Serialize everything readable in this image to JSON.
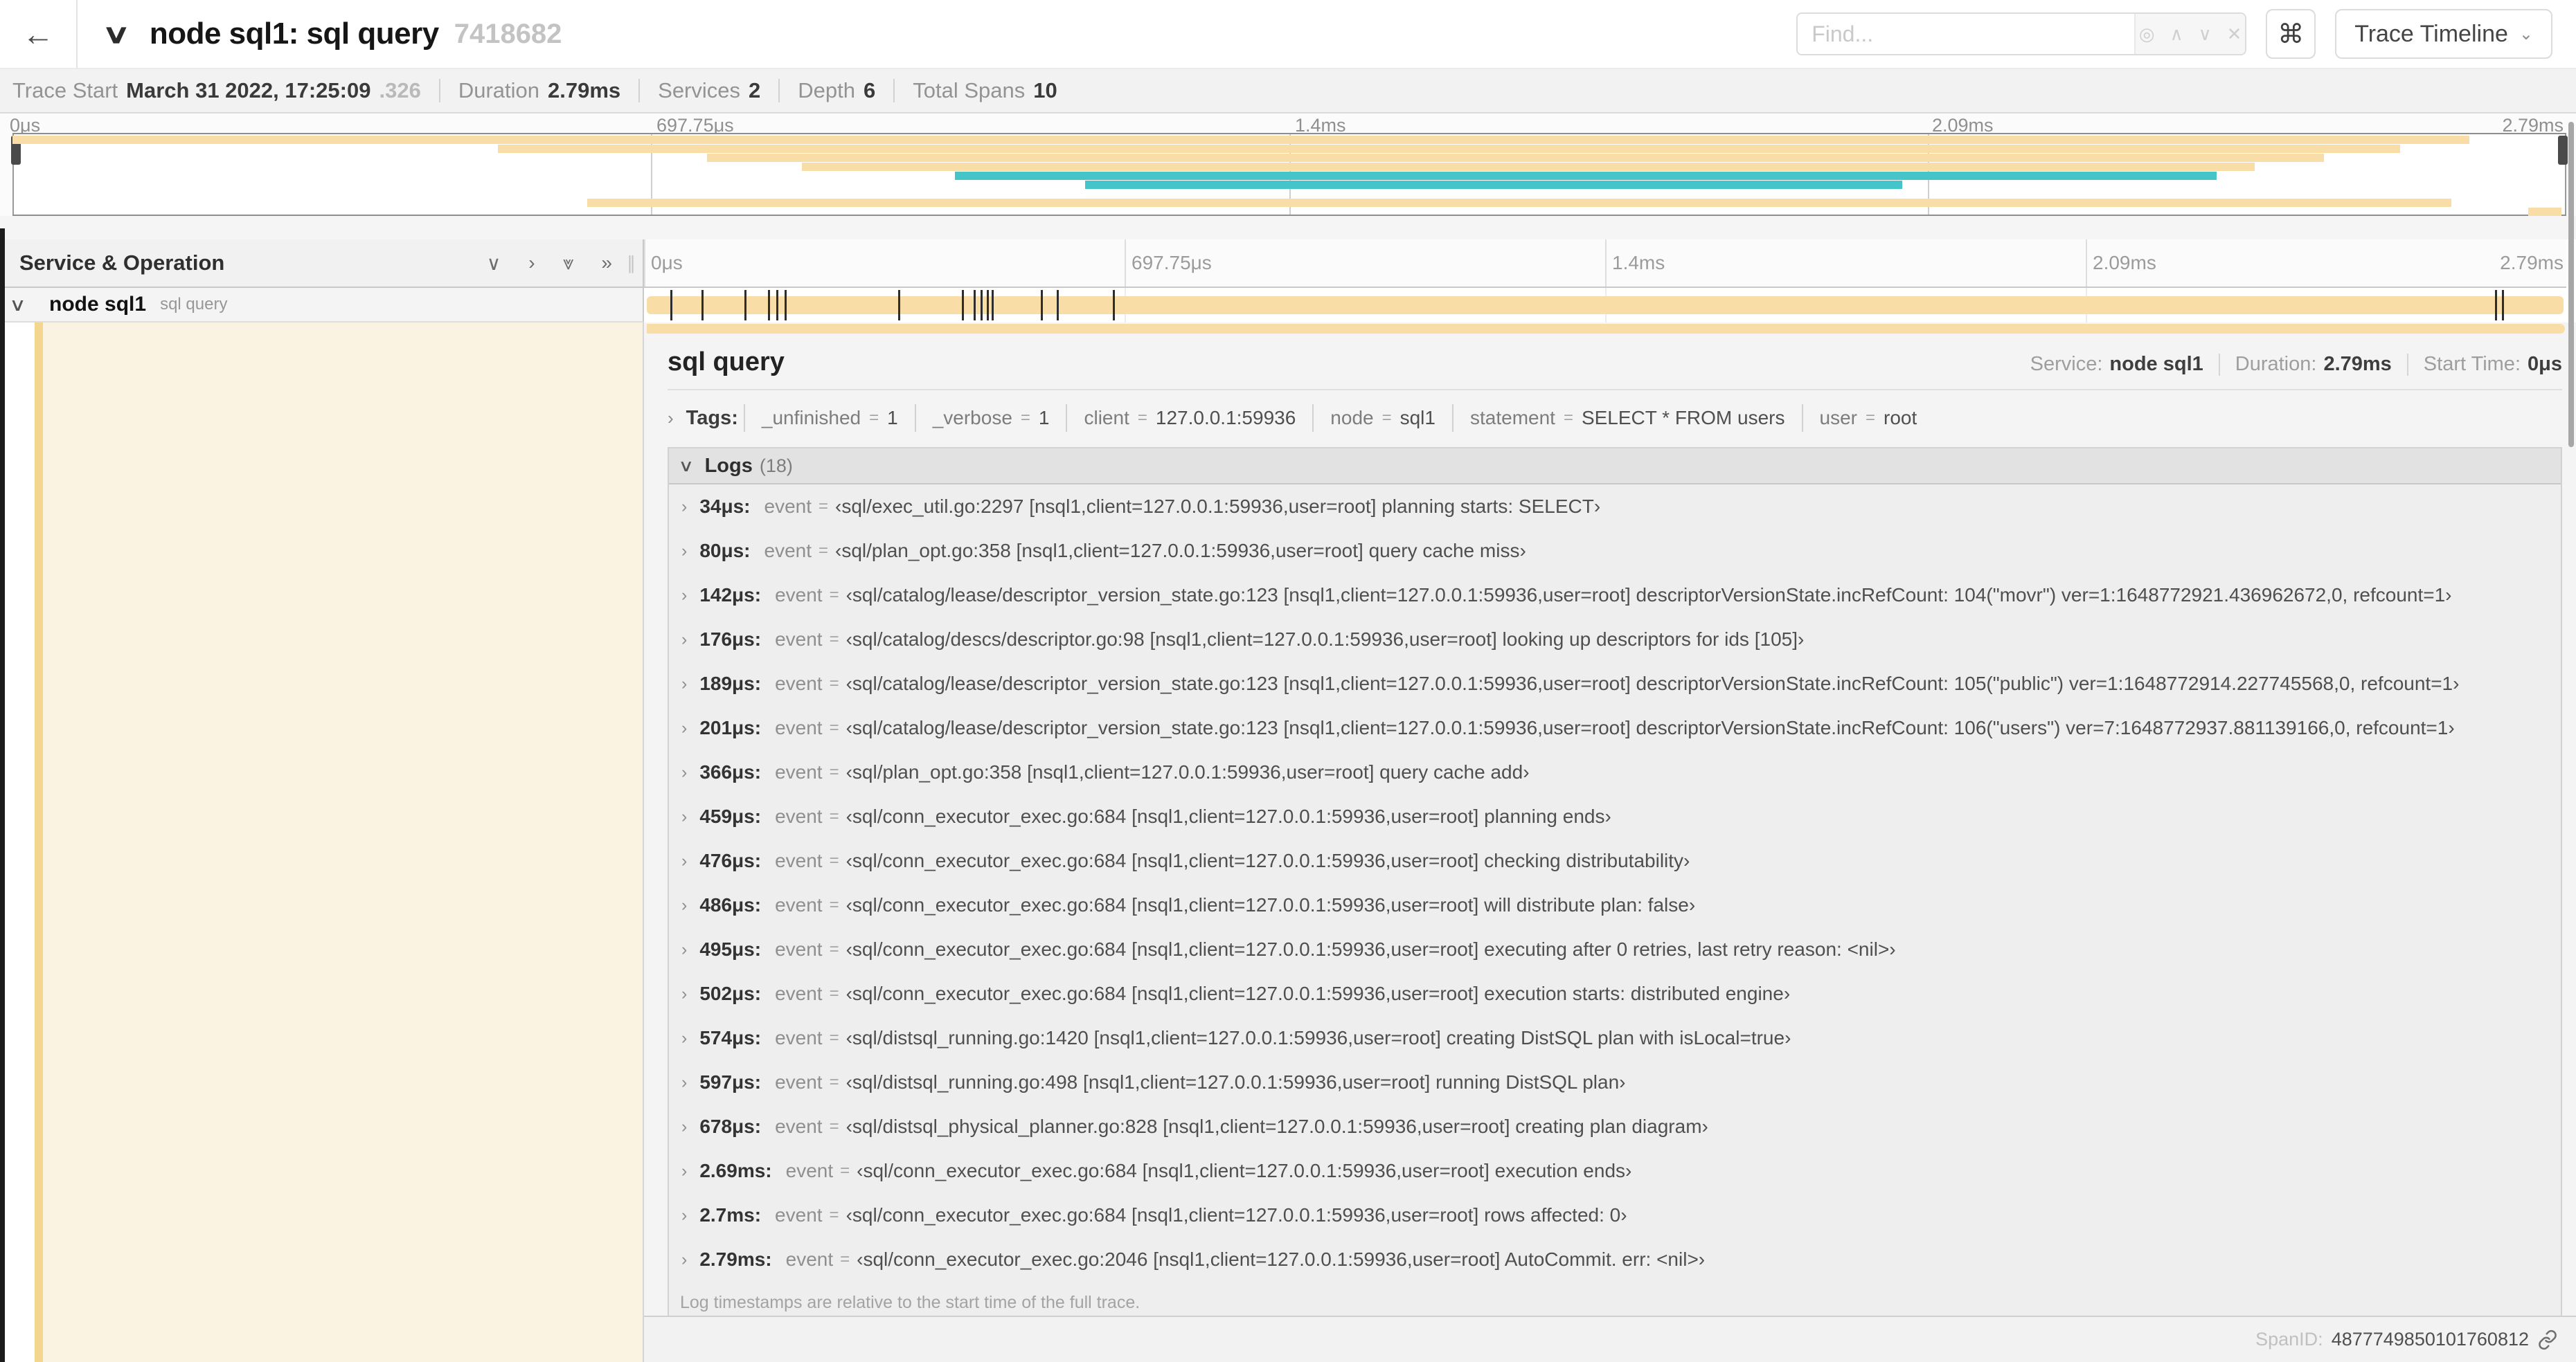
{
  "header": {
    "back_glyph": "←",
    "title_chevron_glyph": "∨",
    "title": "node sql1: sql query",
    "trace_id_short": "7418682",
    "find_placeholder": "Find...",
    "locate_glyph": "◎",
    "prev_glyph": "∧",
    "next_glyph": "∨",
    "clear_glyph": "✕",
    "shortcut_glyph": "⌘",
    "view_selector_label": "Trace Timeline",
    "view_selector_chevron": "⌄"
  },
  "trace_summary": {
    "trace_start_label": "Trace Start",
    "trace_start_value": "March 31 2022, 17:25:09",
    "trace_start_fraction": ".326",
    "duration_label": "Duration",
    "duration_value": "2.79ms",
    "services_label": "Services",
    "services_value": "2",
    "depth_label": "Depth",
    "depth_value": "6",
    "total_spans_label": "Total Spans",
    "total_spans_value": "10"
  },
  "minimap": {
    "ticks": [
      "0μs",
      "697.75μs",
      "1.4ms",
      "2.09ms",
      "2.79ms"
    ],
    "rows": [
      {
        "start": 0.0,
        "end": 0.962,
        "color": "tan"
      },
      {
        "start": 0.19,
        "end": 0.935,
        "color": "tan"
      },
      {
        "start": 0.272,
        "end": 0.905,
        "color": "tan"
      },
      {
        "start": 0.309,
        "end": 0.878,
        "color": "tan"
      },
      {
        "start": 0.369,
        "end": 0.863,
        "color": "teal"
      },
      {
        "start": 0.42,
        "end": 0.74,
        "color": "teal"
      },
      {
        "start": 0.0,
        "end": 0.0,
        "color": "none"
      },
      {
        "start": 0.225,
        "end": 0.955,
        "color": "tan"
      },
      {
        "start": 0.985,
        "end": 0.998,
        "color": "tan"
      }
    ]
  },
  "timeline_header": {
    "left_title": "Service & Operation",
    "collapse_one_glyph": "∨",
    "expand_one_glyph": "›",
    "collapse_all_glyph": "⩔",
    "expand_all_glyph": "»",
    "grip_glyph": "∥",
    "ticks": [
      "0μs",
      "697.75μs",
      "1.4ms",
      "2.09ms",
      "2.79ms"
    ]
  },
  "span_row": {
    "chevron_glyph": "∨",
    "service": "node sql1",
    "operation": "sql query",
    "ticks": [
      0.0122,
      0.0287,
      0.0509,
      0.0631,
      0.0677,
      0.072,
      0.1312,
      0.1645,
      0.1706,
      0.1742,
      0.1774,
      0.1799,
      0.2057,
      0.214,
      0.243,
      0.9642,
      0.9678
    ]
  },
  "detail": {
    "title": "sql query",
    "service_label": "Service:",
    "service_value": "node sql1",
    "duration_label": "Duration:",
    "duration_value": "2.79ms",
    "start_time_label": "Start Time:",
    "start_time_value": "0μs",
    "tags_chevron": "›",
    "tags_label": "Tags:",
    "tags": [
      {
        "key": "_unfinished",
        "value": "1"
      },
      {
        "key": "_verbose",
        "value": "1"
      },
      {
        "key": "client",
        "value": "127.0.0.1:59936"
      },
      {
        "key": "node",
        "value": "sql1"
      },
      {
        "key": "statement",
        "value": "SELECT * FROM users"
      },
      {
        "key": "user",
        "value": "root"
      }
    ],
    "logs_chevron": "∨",
    "logs_label": "Logs",
    "logs_count": "(18)",
    "log_row_chevron": "›",
    "logs": [
      {
        "time": "34μs:",
        "field": "event",
        "value": "‹sql/exec_util.go:2297 [nsql1,client=127.0.0.1:59936,user=root] planning starts: SELECT›"
      },
      {
        "time": "80μs:",
        "field": "event",
        "value": "‹sql/plan_opt.go:358 [nsql1,client=127.0.0.1:59936,user=root] query cache miss›"
      },
      {
        "time": "142μs:",
        "field": "event",
        "value": "‹sql/catalog/lease/descriptor_version_state.go:123 [nsql1,client=127.0.0.1:59936,user=root] descriptorVersionState.incRefCount: 104(\"movr\") ver=1:1648772921.436962672,0, refcount=1›"
      },
      {
        "time": "176μs:",
        "field": "event",
        "value": "‹sql/catalog/descs/descriptor.go:98 [nsql1,client=127.0.0.1:59936,user=root] looking up descriptors for ids [105]›"
      },
      {
        "time": "189μs:",
        "field": "event",
        "value": "‹sql/catalog/lease/descriptor_version_state.go:123 [nsql1,client=127.0.0.1:59936,user=root] descriptorVersionState.incRefCount: 105(\"public\") ver=1:1648772914.227745568,0, refcount=1›"
      },
      {
        "time": "201μs:",
        "field": "event",
        "value": "‹sql/catalog/lease/descriptor_version_state.go:123 [nsql1,client=127.0.0.1:59936,user=root] descriptorVersionState.incRefCount: 106(\"users\") ver=7:1648772937.881139166,0, refcount=1›"
      },
      {
        "time": "366μs:",
        "field": "event",
        "value": "‹sql/plan_opt.go:358 [nsql1,client=127.0.0.1:59936,user=root] query cache add›"
      },
      {
        "time": "459μs:",
        "field": "event",
        "value": "‹sql/conn_executor_exec.go:684 [nsql1,client=127.0.0.1:59936,user=root] planning ends›"
      },
      {
        "time": "476μs:",
        "field": "event",
        "value": "‹sql/conn_executor_exec.go:684 [nsql1,client=127.0.0.1:59936,user=root] checking distributability›"
      },
      {
        "time": "486μs:",
        "field": "event",
        "value": "‹sql/conn_executor_exec.go:684 [nsql1,client=127.0.0.1:59936,user=root] will distribute plan: false›"
      },
      {
        "time": "495μs:",
        "field": "event",
        "value": "‹sql/conn_executor_exec.go:684 [nsql1,client=127.0.0.1:59936,user=root] executing after 0 retries, last retry reason: <nil>›"
      },
      {
        "time": "502μs:",
        "field": "event",
        "value": "‹sql/conn_executor_exec.go:684 [nsql1,client=127.0.0.1:59936,user=root] execution starts: distributed engine›"
      },
      {
        "time": "574μs:",
        "field": "event",
        "value": "‹sql/distsql_running.go:1420 [nsql1,client=127.0.0.1:59936,user=root] creating DistSQL plan with isLocal=true›"
      },
      {
        "time": "597μs:",
        "field": "event",
        "value": "‹sql/distsql_running.go:498 [nsql1,client=127.0.0.1:59936,user=root] running DistSQL plan›"
      },
      {
        "time": "678μs:",
        "field": "event",
        "value": "‹sql/distsql_physical_planner.go:828 [nsql1,client=127.0.0.1:59936,user=root] creating plan diagram›"
      },
      {
        "time": "2.69ms:",
        "field": "event",
        "value": "‹sql/conn_executor_exec.go:684 [nsql1,client=127.0.0.1:59936,user=root] execution ends›"
      },
      {
        "time": "2.7ms:",
        "field": "event",
        "value": "‹sql/conn_executor_exec.go:684 [nsql1,client=127.0.0.1:59936,user=root] rows affected: 0›"
      },
      {
        "time": "2.79ms:",
        "field": "event",
        "value": "‹sql/conn_executor_exec.go:2046 [nsql1,client=127.0.0.1:59936,user=root] AutoCommit. err: <nil>›"
      }
    ],
    "logs_note": "Log timestamps are relative to the start time of the full trace.",
    "span_id_label": "SpanID:",
    "span_id_value": "4877749850101760812"
  },
  "colors": {
    "tan": "#F8DEA6",
    "teal": "#45C5C9",
    "cream": "#FBF3E1",
    "strip": "#F3D78E"
  }
}
